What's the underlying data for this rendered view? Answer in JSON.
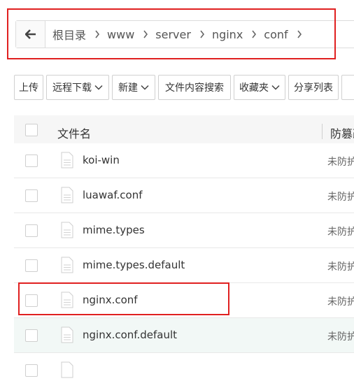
{
  "breadcrumb": {
    "items": [
      "根目录",
      "www",
      "server",
      "nginx",
      "conf"
    ]
  },
  "toolbar": {
    "upload": "上传",
    "remote_download": "远程下载",
    "new": "新建",
    "content_search": "文件内容搜索",
    "favorites": "收藏夹",
    "share_list": "分享列表"
  },
  "table": {
    "header_name": "文件名",
    "header_protect": "防篡改",
    "rows": [
      {
        "name": "koi-win",
        "protect": "未防护"
      },
      {
        "name": "luawaf.conf",
        "protect": "未防护"
      },
      {
        "name": "mime.types",
        "protect": "未防护"
      },
      {
        "name": "mime.types.default",
        "protect": "未防护"
      },
      {
        "name": "nginx.conf",
        "protect": "未防护"
      },
      {
        "name": "nginx.conf.default",
        "protect": "未防护"
      }
    ]
  },
  "colors": {
    "highlight_red": "#e02020",
    "row_hover": "#f2f8f6"
  }
}
